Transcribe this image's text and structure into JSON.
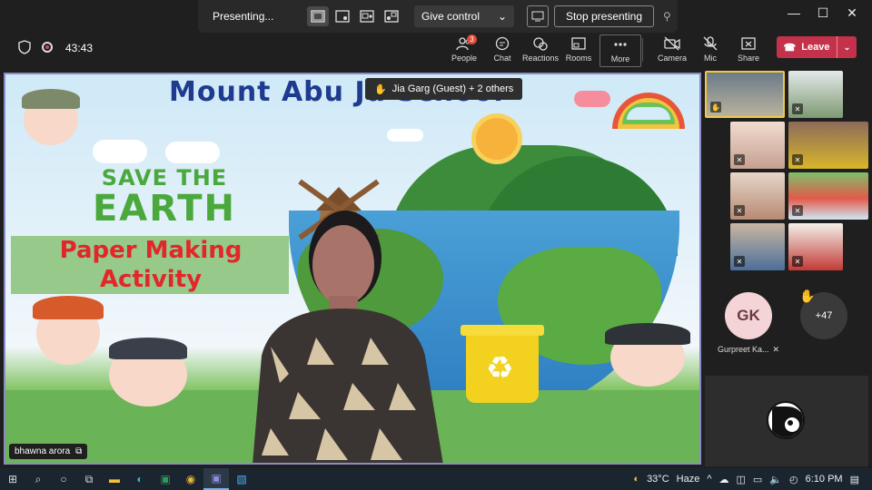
{
  "present_bar": {
    "label": "Presenting...",
    "give_control": "Give control",
    "stop_presenting": "Stop presenting"
  },
  "window": {
    "minimize": "—",
    "maximize": "☐",
    "close": "✕"
  },
  "meeting": {
    "timer": "43:43",
    "toolbar": [
      {
        "label": "People",
        "icon": "people-icon",
        "badge": "3"
      },
      {
        "label": "Chat",
        "icon": "chat-icon"
      },
      {
        "label": "Reactions",
        "icon": "reactions-icon"
      },
      {
        "label": "Rooms",
        "icon": "rooms-icon"
      },
      {
        "label": "More",
        "icon": "more-icon"
      },
      {
        "label": "Camera",
        "icon": "camera-off-icon"
      },
      {
        "label": "Mic",
        "icon": "mic-off-icon"
      },
      {
        "label": "Share",
        "icon": "share-icon"
      }
    ],
    "leave": "Leave"
  },
  "stage": {
    "school_title": "Mount Abu Ju     School",
    "save_line1": "SAVE THE",
    "save_line2": "EARTH",
    "activity_line1": "Paper Making",
    "activity_line2": "Activity",
    "speaker_toast": "Jia Garg (Guest) + 2 others",
    "presenter_name": "bhawna arora"
  },
  "side": {
    "gk_initials": "GK",
    "gk_name": "Gurpreet Ka...",
    "overflow_count": "+47"
  },
  "taskbar": {
    "weather_temp": "33°C",
    "weather_desc": "Haze",
    "time": "6:10 PM"
  },
  "colors": {
    "leave": "#c4314b",
    "selected_tile": "#f2c744",
    "stage_border": "#8b8cc7"
  }
}
